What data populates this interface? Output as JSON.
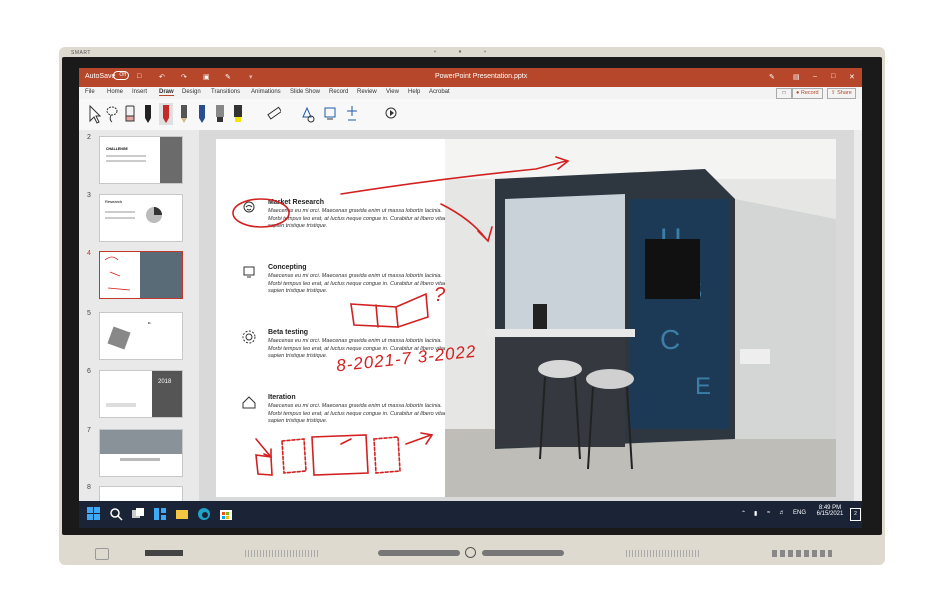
{
  "device": {
    "brand": "SMART"
  },
  "window": {
    "autosave_label": "AutoSave",
    "autosave_state": "Off",
    "title": "PowerPoint Presentation.pptx",
    "record_label": "Record",
    "share_label": "Share"
  },
  "ribbon_tabs": [
    "File",
    "Home",
    "Insert",
    "Draw",
    "Design",
    "Transitions",
    "Animations",
    "Slide Show",
    "Record",
    "Review",
    "View",
    "Help",
    "Acrobat"
  ],
  "active_tab": "Draw",
  "thumbnails": [
    {
      "num": "2",
      "label": "CHALLENGE"
    },
    {
      "num": "3",
      "label": "Research"
    },
    {
      "num": "4",
      "label": ""
    },
    {
      "num": "5",
      "label": ""
    },
    {
      "num": "6",
      "label": "2018"
    },
    {
      "num": "7",
      "label": ""
    },
    {
      "num": "8",
      "label": ""
    }
  ],
  "slide": {
    "sections": [
      {
        "title": "Market Research",
        "body": "Maecenas eu mi orci. Maecenas gravida enim ut massa lobortis lacinia. Morbi tempus leo erat, at luctus neque congue in. Curabitur at libero vitae sapien tristique tristique."
      },
      {
        "title": "Concepting",
        "body": "Maecenas eu mi orci. Maecenas gravida enim ut massa lobortis lacinia. Morbi tempus leo erat, at luctus neque congue in. Curabitur at libero vitae sapien tristique tristique."
      },
      {
        "title": "Beta testing",
        "body": "Maecenas eu mi orci. Maecenas gravida enim ut massa lobortis lacinia. Morbi tempus leo erat, at luctus neque congue in. Curabitur at libero vitae sapien tristique tristique."
      },
      {
        "title": "Iteration",
        "body": "Maecenas eu mi orci. Maecenas gravida enim ut massa lobortis lacinia. Morbi tempus leo erat, at luctus neque congue in. Curabitur at libero vitae sapien tristique tristique."
      }
    ],
    "ink_text": "8-2021-7 3-2022",
    "ink_question": "?"
  },
  "taskbar": {
    "lang": "ENG",
    "time": "8:49 PM",
    "date": "6/15/2021",
    "notif_count": "2"
  },
  "colors": {
    "accent": "#b7472a",
    "ink": "#d32020",
    "taskbar": "#1b2336"
  }
}
